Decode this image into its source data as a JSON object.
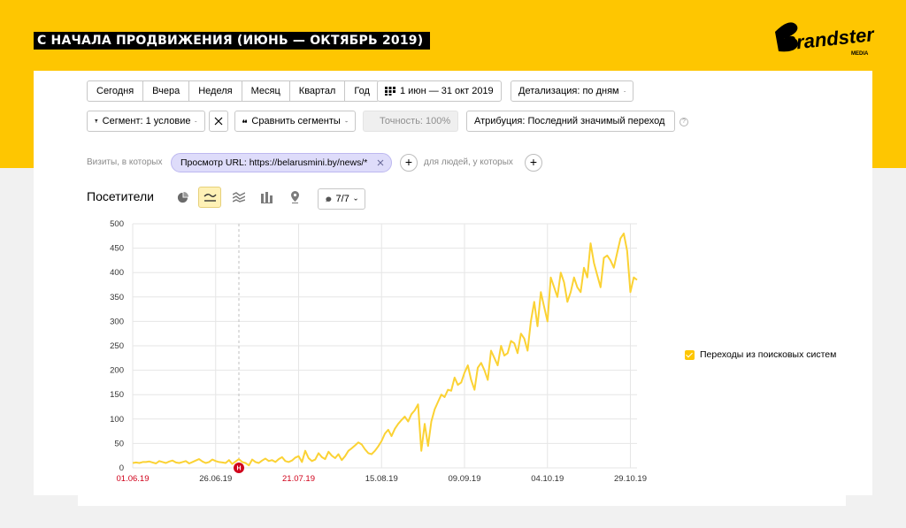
{
  "hero": {
    "title": "С НАЧАЛА ПРОДВИЖЕНИЯ (ИЮНЬ — ОКТЯБРЬ 2019)"
  },
  "logo": {
    "text": "Brandster",
    "sub": "MEDIA"
  },
  "toolbar": {
    "periods": [
      "Сегодня",
      "Вчера",
      "Неделя",
      "Месяц",
      "Квартал",
      "Год"
    ],
    "date_range": "1 июн — 31 окт 2019",
    "detail": "Детализация: по дням",
    "segment": "Сегмент: 1 условие",
    "compare": "Сравнить сегменты",
    "accuracy": "Точность: 100%",
    "attribution": "Атрибуция: Последний значимый переход"
  },
  "filter": {
    "visits_label": "Визиты, в которых",
    "chip": "Просмотр URL: https://belarusmini.by/news/*",
    "people_label": "для людей, у которых"
  },
  "report": {
    "title": "Посетители",
    "metrics_count": "7/7"
  },
  "colors": {
    "brand_yellow": "#fec601",
    "line": "#fbd234",
    "holiday_red": "#d0021b"
  },
  "chart_data": {
    "type": "line",
    "ylim": [
      0,
      500
    ],
    "yticks": [
      "0",
      "50",
      "100",
      "150",
      "200",
      "250",
      "300",
      "350",
      "400",
      "450",
      "500"
    ],
    "xtick_labels": [
      "01.06.19",
      "26.06.19",
      "21.07.19",
      "15.08.19",
      "09.09.19",
      "04.10.19",
      "29.10.19"
    ],
    "xtick_days": [
      0,
      25,
      50,
      75,
      100,
      125,
      150
    ],
    "xtick_holiday": [
      true,
      false,
      true,
      false,
      false,
      false,
      false
    ],
    "x_start": "01.06.19",
    "x_end": "31.10.19",
    "grid": true,
    "legend_position": "right",
    "annotation_marker": "Н",
    "annotation_day": 32,
    "series": [
      {
        "name": "Переходы из поисковых систем",
        "values": [
          10,
          11,
          10,
          12,
          12,
          13,
          11,
          9,
          14,
          12,
          10,
          13,
          15,
          11,
          10,
          12,
          14,
          9,
          12,
          15,
          18,
          13,
          10,
          12,
          17,
          14,
          12,
          11,
          10,
          16,
          8,
          13,
          18,
          12,
          10,
          5,
          17,
          12,
          10,
          15,
          19,
          14,
          16,
          12,
          18,
          22,
          14,
          12,
          15,
          21,
          24,
          12,
          35,
          20,
          14,
          17,
          30,
          22,
          18,
          33,
          25,
          20,
          28,
          16,
          24,
          35,
          40,
          46,
          52,
          48,
          38,
          30,
          28,
          35,
          44,
          55,
          70,
          78,
          65,
          80,
          90,
          98,
          105,
          95,
          110,
          118,
          130,
          35,
          90,
          45,
          95,
          120,
          135,
          150,
          145,
          160,
          158,
          185,
          170,
          175,
          195,
          210,
          180,
          160,
          205,
          215,
          200,
          180,
          240,
          225,
          210,
          250,
          230,
          235,
          260,
          255,
          235,
          275,
          265,
          240,
          300,
          340,
          290,
          360,
          330,
          300,
          390,
          370,
          350,
          400,
          380,
          340,
          360,
          390,
          370,
          360,
          410,
          390,
          460,
          420,
          395,
          370,
          430,
          435,
          425,
          410,
          440,
          470,
          480,
          445,
          360,
          390,
          385
        ]
      }
    ]
  }
}
